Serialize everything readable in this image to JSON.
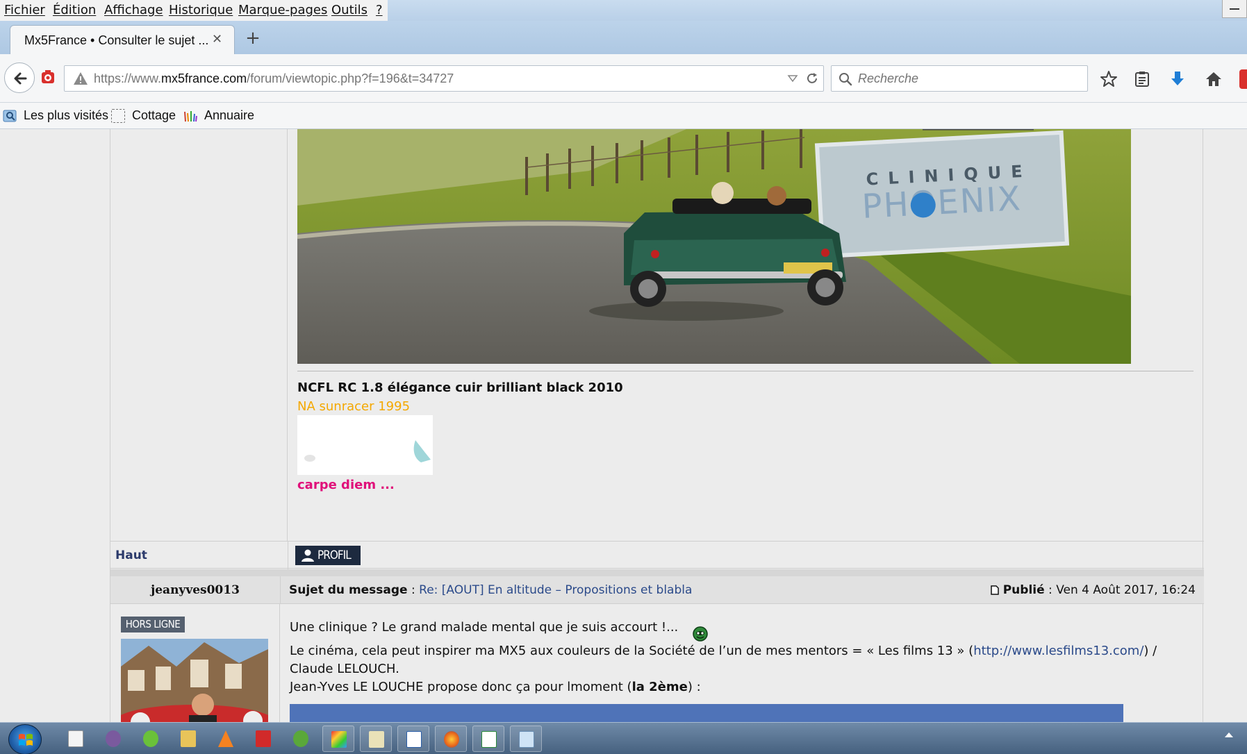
{
  "menu": {
    "items": [
      "Fichier",
      "Édition",
      "Affichage",
      "Historique",
      "Marque-pages",
      "Outils",
      "?"
    ]
  },
  "tab": {
    "title": "Mx5France • Consulter le sujet ...",
    "close": "✕",
    "new": "+"
  },
  "nav": {
    "url_prefix": "https://www.",
    "url_domain": "mx5france.com",
    "url_path": "/forum/viewtopic.php?f=196&t=34727",
    "search_placeholder": "Recherche"
  },
  "bookmarks": {
    "items": [
      "Les plus visités",
      "Cottage",
      "Annuaire"
    ]
  },
  "post1": {
    "signature": {
      "car": "NCFL RC 1.8 élégance cuir brilliant black 2010",
      "na": "NA sunracer 1995",
      "motto": "carpe diem ..."
    },
    "footer": {
      "top_link": "Haut",
      "profile_button": "PROFIL"
    }
  },
  "post2": {
    "author": "jeanyves0013",
    "status": "HORS LIGNE",
    "subject_label": "Sujet du message",
    "subject_sep": " : ",
    "subject": "Re: [AOUT] En altitude – Propositions et blabla",
    "published_label": "Publié",
    "published_sep": " : ",
    "published_date": "Ven 4 Août 2017, 16:24",
    "line1": "Une clinique ? Le grand malade mental que je suis accourt !...",
    "line2_pre": "Le cinéma, cela peut inspirer ma MX5 aux couleurs de la Société de l’un de mes mentors = « Les films 13 » (",
    "line2_link": "http://www.lesfilms13.com/",
    "line2_post": ") /",
    "line3": "Claude LELOUCH.",
    "line4_pre": "Jean-Yves LE LOUCHE propose donc ça pour lmoment (",
    "line4_bold": "la 2ème",
    "line4_post": ") :"
  },
  "colors": {
    "na_text": "#f4a800",
    "motto_text": "#e0107a",
    "link": "#2b4a8a",
    "profile_button_bg": "#1d2a3f",
    "status_badge_bg": "#55606f"
  },
  "icons": {
    "back": "arrow-left-icon",
    "warning": "warning-triangle-icon",
    "reload": "reload-icon",
    "search": "search-icon",
    "bookmark_star": "star-icon",
    "reading_list": "clipboard-icon",
    "download": "download-arrow-icon",
    "home": "home-icon",
    "smiley": "smiley-icon"
  }
}
